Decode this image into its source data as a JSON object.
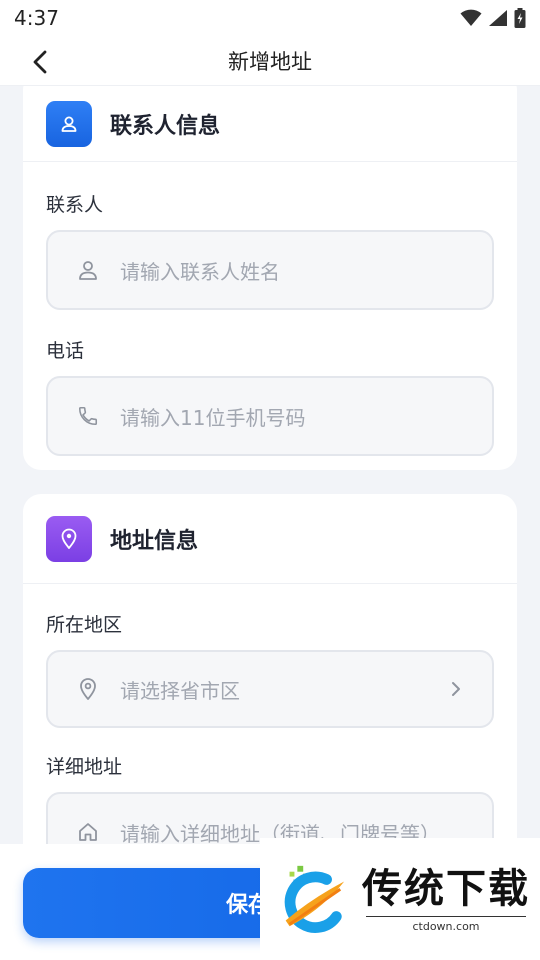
{
  "status_bar": {
    "time": "4:37"
  },
  "app_bar": {
    "title": "新增地址"
  },
  "contact_card": {
    "title": "联系人信息",
    "name_label": "联系人",
    "name_placeholder": "请输入联系人姓名",
    "phone_label": "电话",
    "phone_placeholder": "请输入11位手机号码"
  },
  "address_card": {
    "title": "地址信息",
    "region_label": "所在地区",
    "region_placeholder": "请选择省市区",
    "detail_label": "详细地址",
    "detail_placeholder": "请输入详细地址（街道、门牌号等）"
  },
  "bottom": {
    "save_label": "保存地址"
  },
  "watermark": {
    "brand": "传统下载",
    "domain": "ctdown.com"
  },
  "colors": {
    "accent": "#1f74ef",
    "contact_badge": "#2f7ff5",
    "address_badge": "#8a4ef0"
  },
  "icons": [
    "back-arrow-icon",
    "wifi-icon",
    "signal-icon",
    "battery-icon",
    "person-icon",
    "phone-icon",
    "location-pin-icon",
    "chevron-right-icon",
    "home-icon"
  ]
}
